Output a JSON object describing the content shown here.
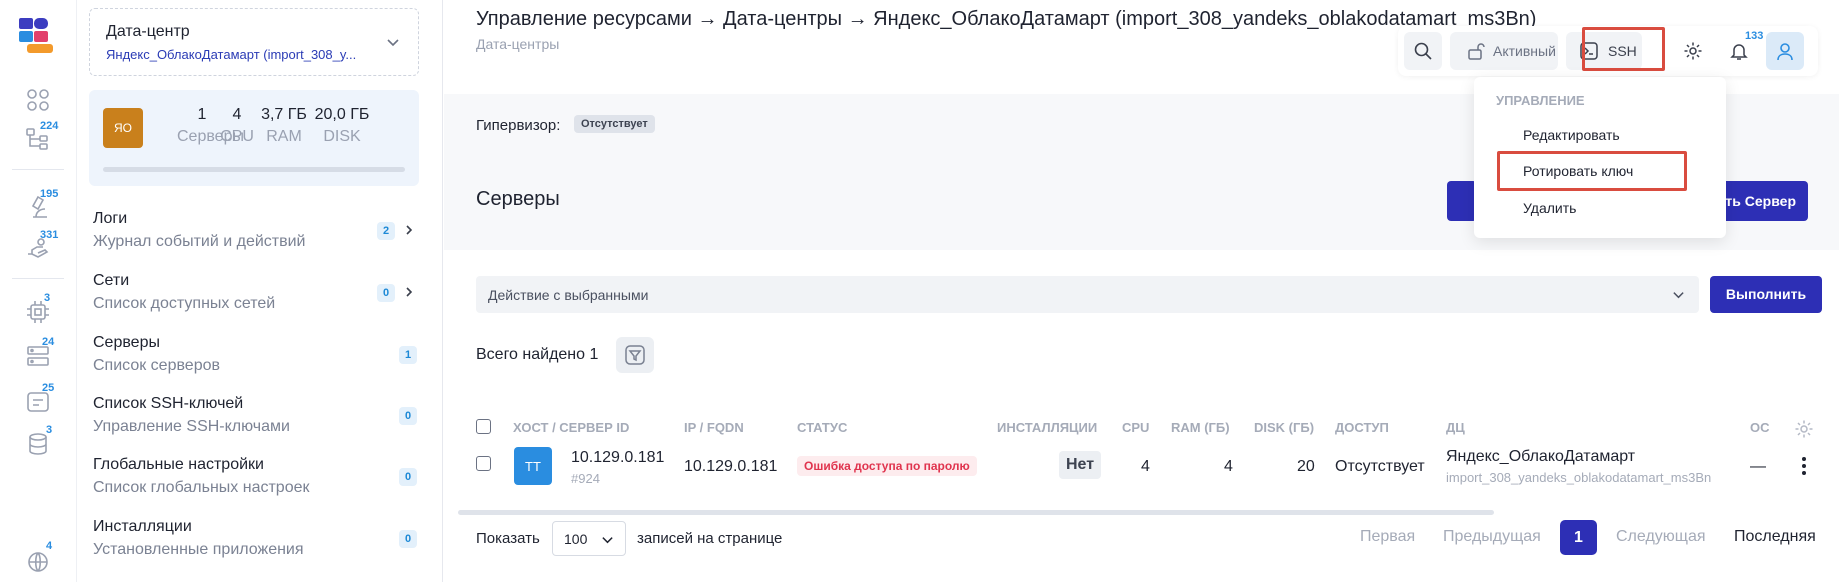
{
  "rail": {
    "badges": {
      "tree": "224",
      "microscope": "195",
      "hand": "331",
      "chip": "3",
      "server": "24",
      "board": "25",
      "db": "3",
      "globe": "4"
    }
  },
  "sidebar": {
    "dc_title": "Дата-центр",
    "dc_name": "Яндекс_ОблакоДатамарт (import_308_y...",
    "stats": {
      "avatar": "ЯО",
      "items": [
        {
          "value": "1",
          "label": "Серверы"
        },
        {
          "value": "4",
          "label": "CPU"
        },
        {
          "value": "3,7 ГБ",
          "label": "RAM"
        },
        {
          "value": "20,0 ГБ",
          "label": "DISK"
        }
      ]
    },
    "nav": [
      {
        "title": "Логи",
        "subtitle": "Журнал событий и действий",
        "count": "2"
      },
      {
        "title": "Сети",
        "subtitle": "Список доступных сетей",
        "count": "0"
      },
      {
        "title": "Серверы",
        "subtitle": "Список серверов",
        "count": "1"
      },
      {
        "title": "Список SSH-ключей",
        "subtitle": "Управление SSH-ключами",
        "count": "0"
      },
      {
        "title": "Глобальные настройки",
        "subtitle": "Список глобальных настроек",
        "count": "0"
      },
      {
        "title": "Инсталляции",
        "subtitle": "Установленные приложения",
        "count": "0"
      }
    ]
  },
  "header": {
    "breadcrumb": "Управление ресурсами → Дата-центры → Яндекс_ОблакоДатамарт (import_308_yandeks_oblakodatamart_ms3Bn)",
    "subtitle": "Дата-центры",
    "status_label": "Активный",
    "ssh_label": "SSH",
    "notifications": "133"
  },
  "dropdown": {
    "heading": "УПРАВЛЕНИЕ",
    "items": [
      "Редактировать",
      "Ротировать ключ",
      "Удалить"
    ]
  },
  "main": {
    "hypervisor_label": "Гипервизор:",
    "hypervisor_value": "Отсутствует",
    "servers_heading": "Серверы",
    "add_button": "авить Сервер",
    "bulk_placeholder": "Действие с выбранными",
    "execute_button": "Выполнить",
    "found_text": "Всего найдено 1"
  },
  "table": {
    "columns": [
      "ХОСТ / СЕРВЕР ID",
      "IP / FQDN",
      "СТАТУС",
      "ИНСТАЛЛЯЦИИ",
      "CPU",
      "RAM (ГБ)",
      "DISK (ГБ)",
      "ДОСТУП",
      "ДЦ",
      "ОС"
    ],
    "rows": [
      {
        "avatar": "TT",
        "host": "10.129.0.181",
        "id": "#924",
        "ip": "10.129.0.181",
        "status": "Ошибка доступа по паролю",
        "installations": "Нет",
        "cpu": "4",
        "ram": "4",
        "disk": "20",
        "access": "Отсутствует",
        "dc": "Яндекс_ОблакоДатамарт",
        "dc_sub": "import_308_yandeks_oblakodatamart_ms3Bn",
        "os": "—"
      }
    ]
  },
  "pagination": {
    "show_label": "Показать",
    "per_page": "100",
    "per_page_suffix": "записей на странице",
    "first": "Первая",
    "prev": "Предыдущая",
    "current": "1",
    "next": "Следующая",
    "last": "Последняя"
  },
  "colors": {
    "accent": "#2d2fb5",
    "link": "#2a3bb5",
    "badge": "#2a8de0",
    "error": "#e0344e",
    "highlight": "#d94c3f"
  }
}
